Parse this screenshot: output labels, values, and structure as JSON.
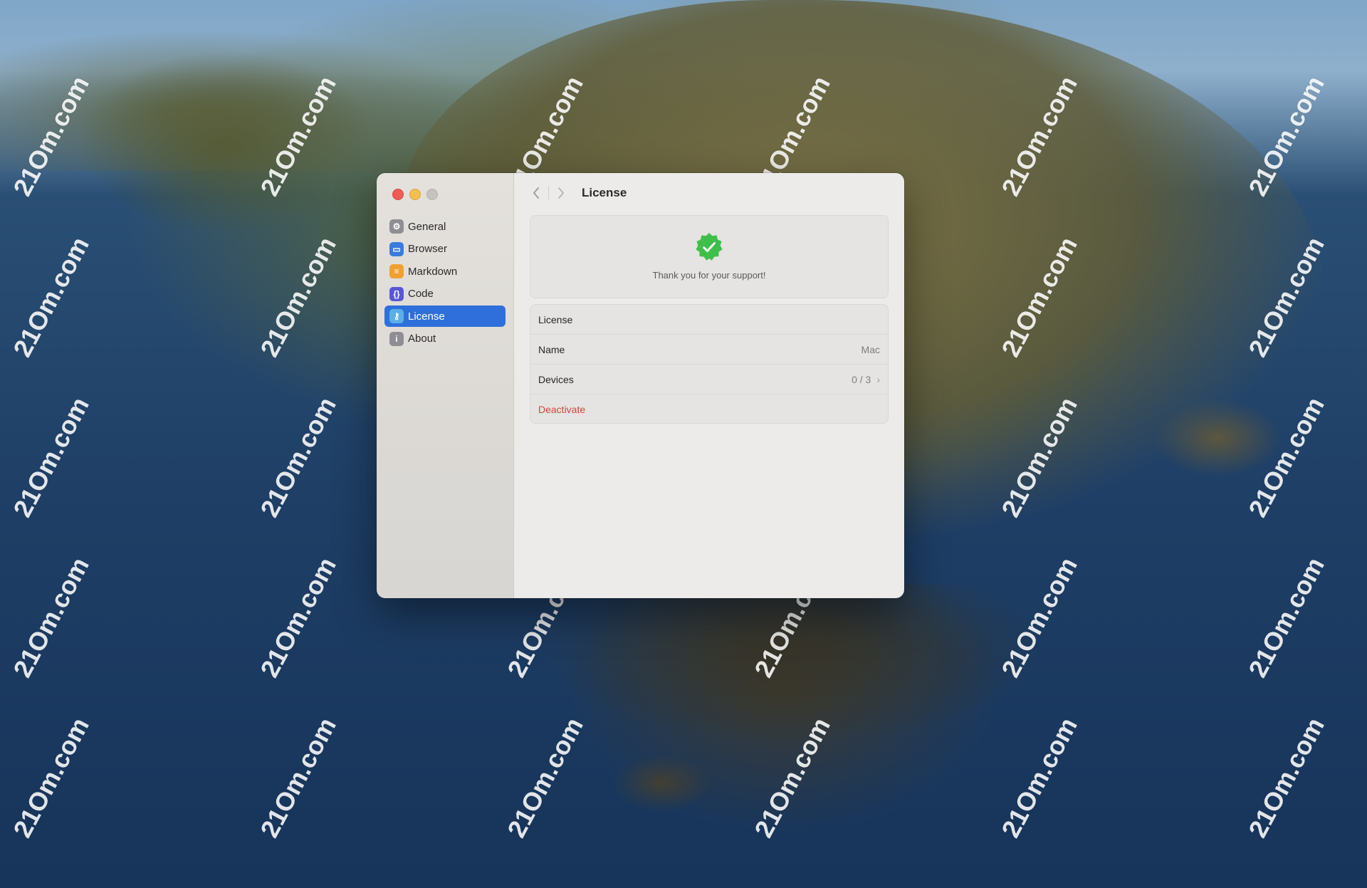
{
  "window": {
    "title": "License",
    "controls": {
      "close": "close",
      "minimize": "minimize",
      "zoom": "zoom"
    }
  },
  "toolbar": {
    "back_icon": "chevron-left-icon",
    "forward_icon": "chevron-right-icon",
    "title": "License"
  },
  "sidebar": {
    "items": [
      {
        "label": "General",
        "icon": "gear-icon",
        "glyph": "⚙",
        "active": false
      },
      {
        "label": "Browser",
        "icon": "browser-window-icon",
        "glyph": "▭",
        "active": false
      },
      {
        "label": "Markdown",
        "icon": "document-icon",
        "glyph": "≡",
        "active": false
      },
      {
        "label": "Code",
        "icon": "braces-icon",
        "glyph": "{}",
        "active": false
      },
      {
        "label": "License",
        "icon": "key-icon",
        "glyph": "⚷",
        "active": true
      },
      {
        "label": "About",
        "icon": "info-icon",
        "glyph": "i",
        "active": false
      }
    ]
  },
  "license_status": {
    "message": "Thank you for your support!",
    "badge_icon": "verified-check-badge-icon",
    "badge_color": "#3fbf4a"
  },
  "license_details": {
    "header": "License",
    "name_label": "Name",
    "name_value": "Mac",
    "devices_label": "Devices",
    "devices_value": "0 / 3",
    "deactivate_label": "Deactivate",
    "deactivate_color": "#d2463c"
  },
  "watermark_text": "21Om.com",
  "colors": {
    "accent": "#2f6fdb"
  }
}
